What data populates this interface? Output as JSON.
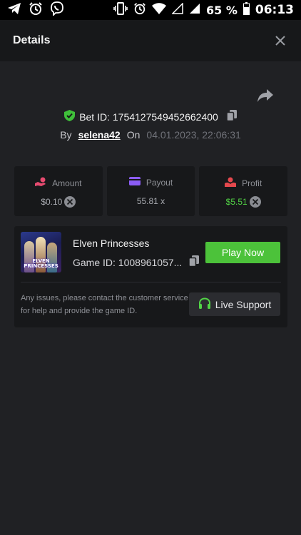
{
  "status_bar": {
    "battery_percent": "65 %",
    "time": "06:13",
    "icons": [
      "telegram-icon",
      "alarm-icon",
      "viber-icon",
      "vibrate-icon",
      "alarm-icon",
      "wifi-icon",
      "signal-icon",
      "signal-icon",
      "battery-icon"
    ]
  },
  "header": {
    "title": "Details",
    "close_icon": "close-icon"
  },
  "bet": {
    "id_label": "Bet ID: 1754127549452662400",
    "by_label": "By",
    "username": "selena42",
    "on_label": "On",
    "date": "04.01.2023, 22:06:31"
  },
  "stats": [
    {
      "label": "Amount",
      "value": "$0.10",
      "icon": "hand-coin-icon",
      "icon_color": "#e74b70",
      "value_color": "#a9abb1",
      "currency_icon": true
    },
    {
      "label": "Payout",
      "value": "55.81 x",
      "icon": "card-icon",
      "icon_color": "#8b5cf6",
      "value_color": "#a9abb1",
      "currency_icon": false
    },
    {
      "label": "Profit",
      "value": "$5.51",
      "icon": "profit-icon",
      "icon_color": "#e5484d",
      "value_color": "#52d446",
      "currency_icon": true
    }
  ],
  "game": {
    "thumbnail_text_line1": "ELVEN",
    "thumbnail_text_line2": "PRINCESSES",
    "name": "Elven Princesses",
    "id_label": "Game ID: 1008961057...",
    "play_label": "Play Now",
    "help_text": "Any issues, please contact the customer service for help and provide the game ID.",
    "support_label": "Live Support"
  },
  "colors": {
    "accent_green": "#4cc23a",
    "background": "#202124",
    "panel": "#17181a"
  }
}
